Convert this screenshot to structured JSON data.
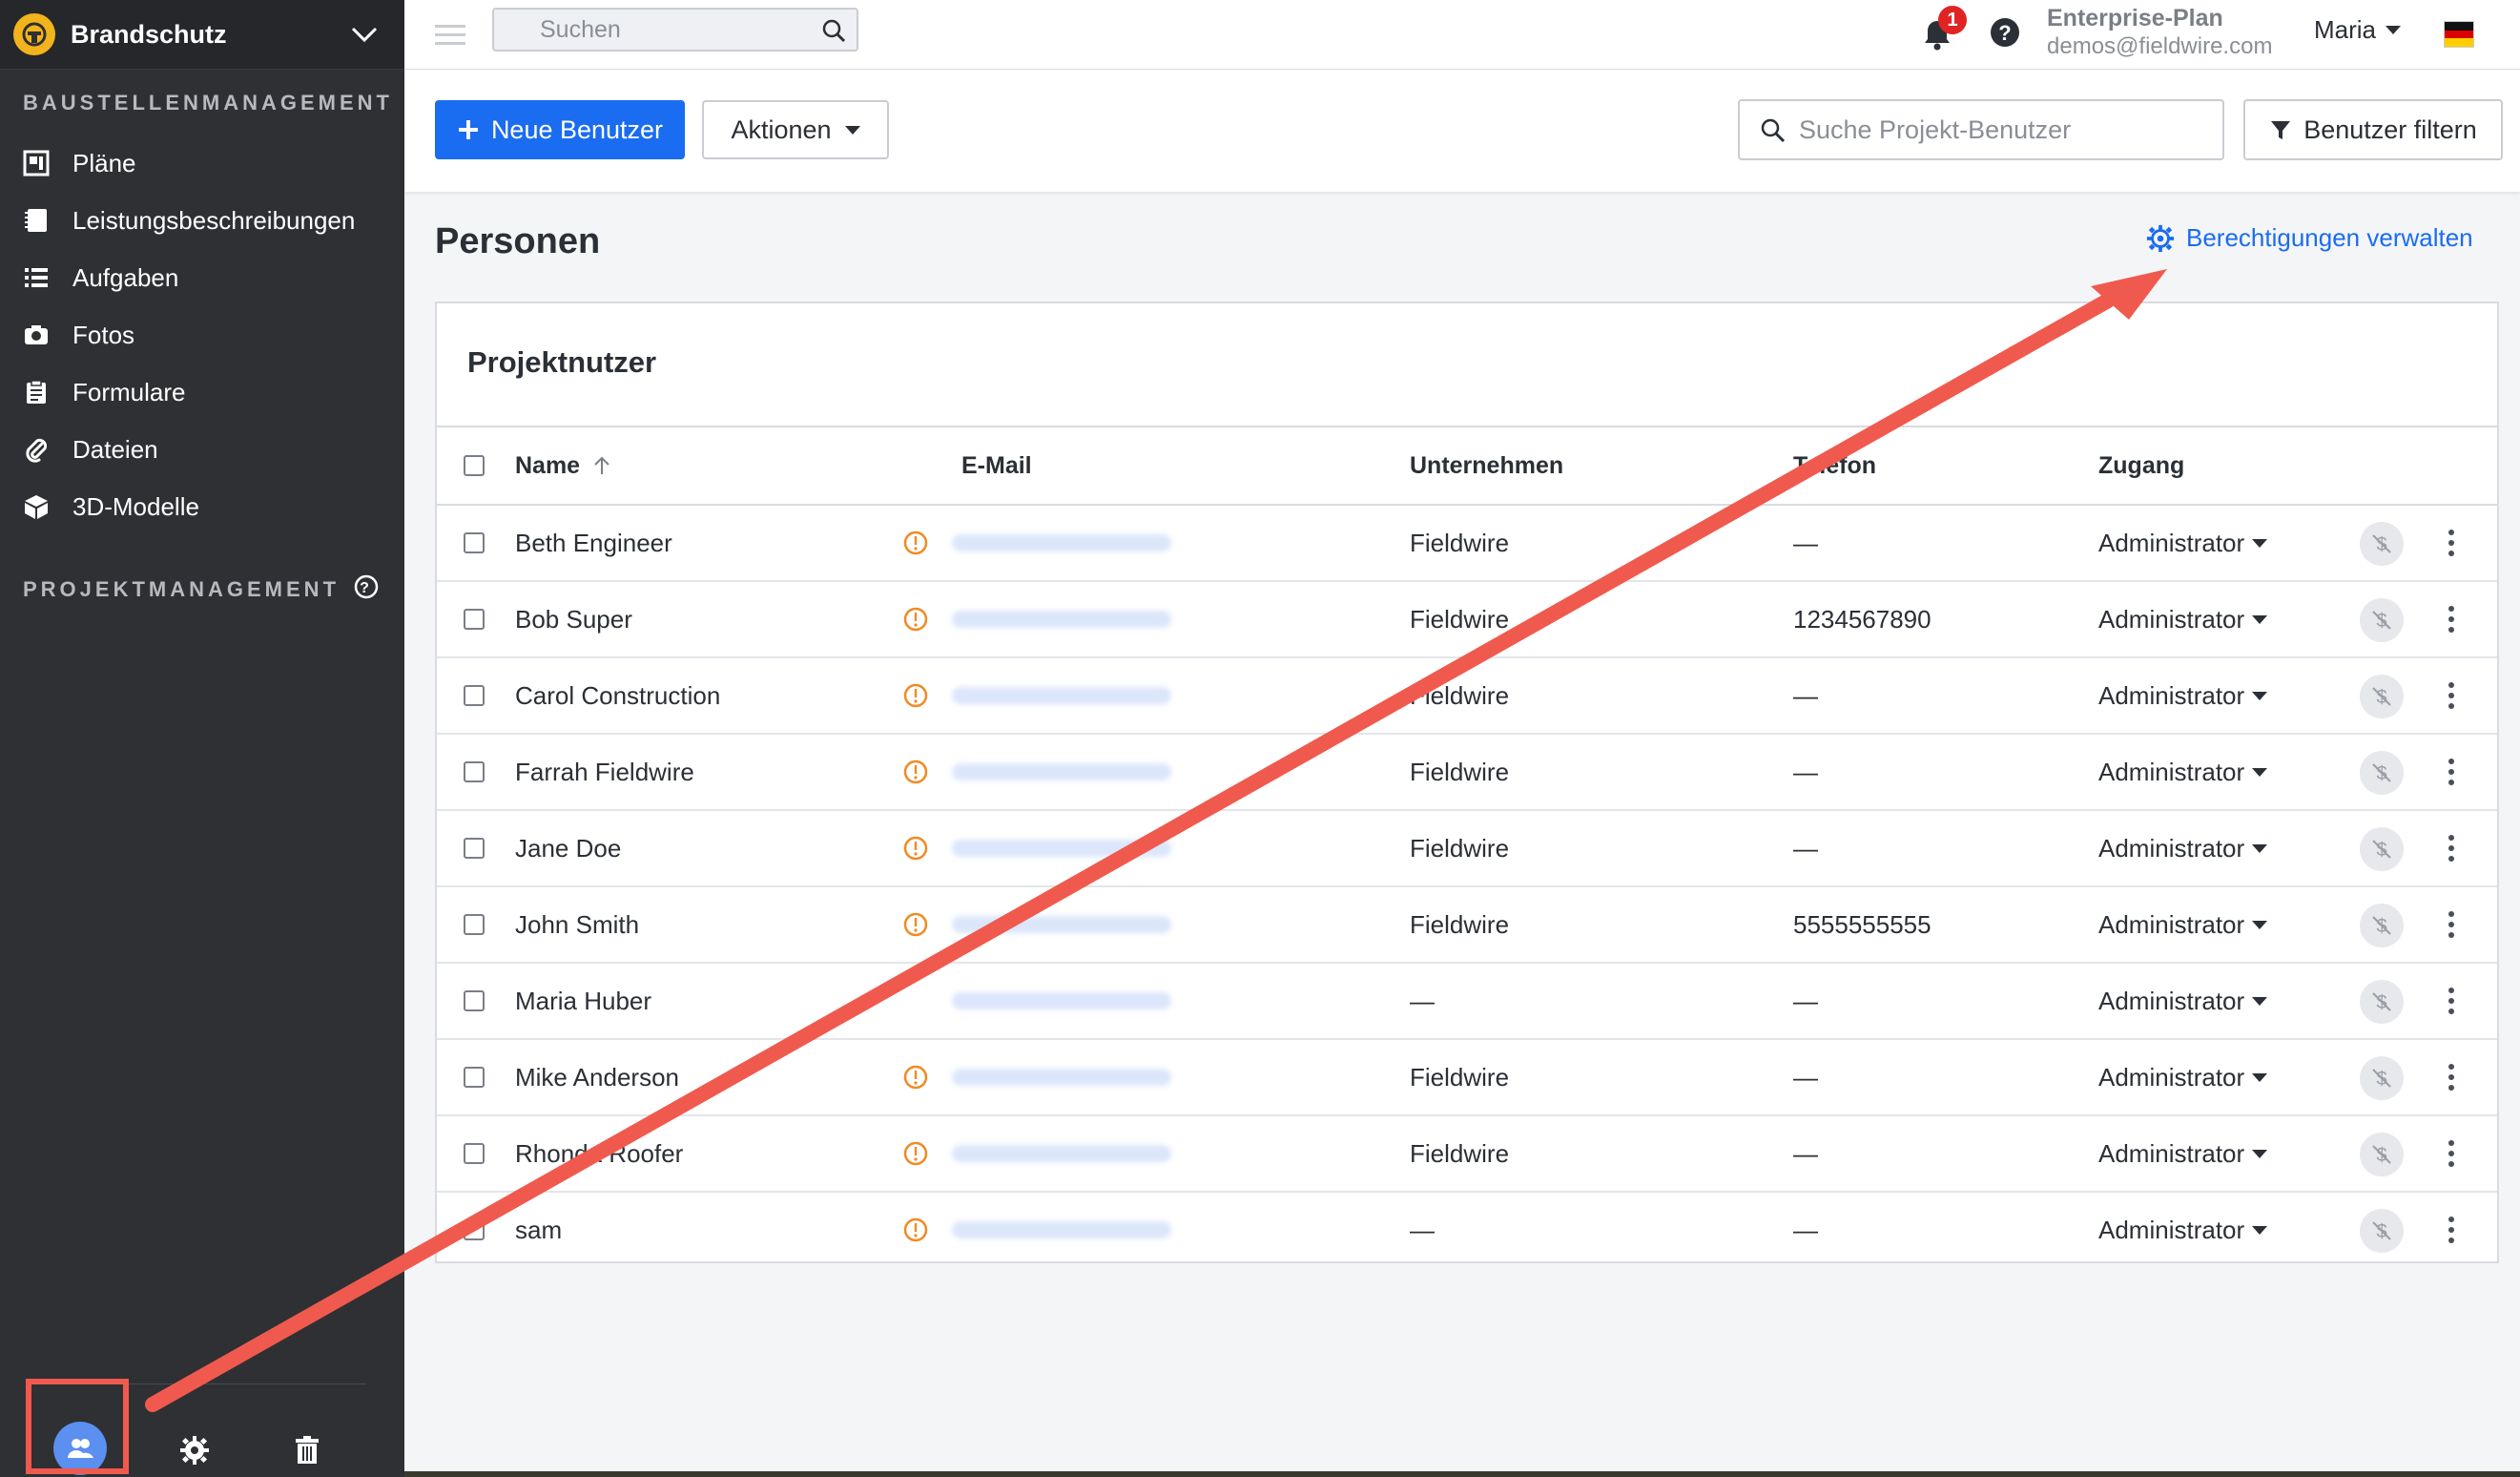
{
  "sidebar": {
    "project_name": "Brandschutz",
    "section_site": "BAUSTELLENMANAGEMENT",
    "items": [
      {
        "label": "Pläne",
        "icon": "plans-icon"
      },
      {
        "label": "Leistungsbeschreibungen",
        "icon": "specs-icon"
      },
      {
        "label": "Aufgaben",
        "icon": "tasks-icon"
      },
      {
        "label": "Fotos",
        "icon": "camera-icon"
      },
      {
        "label": "Formulare",
        "icon": "clipboard-icon"
      },
      {
        "label": "Dateien",
        "icon": "paperclip-icon"
      },
      {
        "label": "3D-Modelle",
        "icon": "cube-icon"
      }
    ],
    "section_project": "PROJEKTMANAGEMENT"
  },
  "topbar": {
    "search_placeholder": "Suchen",
    "notification_count": "1",
    "plan_name": "Enterprise-Plan",
    "email": "demos@fieldwire.com",
    "user_name": "Maria"
  },
  "actions": {
    "new_user": "Neue Benutzer",
    "actions": "Aktionen",
    "user_search_placeholder": "Suche Projekt-Benutzer",
    "filter": "Benutzer filtern"
  },
  "main": {
    "title": "Personen",
    "permissions_link": "Berechtigungen verwalten",
    "card_title": "Projektnutzer",
    "columns": {
      "name": "Name",
      "email": "E-Mail",
      "company": "Unternehmen",
      "phone": "Telefon",
      "access": "Zugang"
    },
    "rows": [
      {
        "name": "Beth Engineer",
        "warn": true,
        "company": "Fieldwire",
        "phone": "—",
        "access": "Administrator"
      },
      {
        "name": "Bob Super",
        "warn": true,
        "company": "Fieldwire",
        "phone": "1234567890",
        "access": "Administrator"
      },
      {
        "name": "Carol Construction",
        "warn": true,
        "company": "Fieldwire",
        "phone": "—",
        "access": "Administrator"
      },
      {
        "name": "Farrah Fieldwire",
        "warn": true,
        "company": "Fieldwire",
        "phone": "—",
        "access": "Administrator"
      },
      {
        "name": "Jane Doe",
        "warn": true,
        "company": "Fieldwire",
        "phone": "—",
        "access": "Administrator"
      },
      {
        "name": "John Smith",
        "warn": true,
        "company": "Fieldwire",
        "phone": "5555555555",
        "access": "Administrator"
      },
      {
        "name": "Maria Huber",
        "warn": false,
        "company": "—",
        "phone": "—",
        "access": "Administrator"
      },
      {
        "name": "Mike Anderson",
        "warn": true,
        "company": "Fieldwire",
        "phone": "—",
        "access": "Administrator"
      },
      {
        "name": "Rhonda Roofer",
        "warn": true,
        "company": "Fieldwire",
        "phone": "—",
        "access": "Administrator"
      },
      {
        "name": "sam",
        "warn": true,
        "company": "—",
        "phone": "—",
        "access": "Administrator"
      }
    ]
  },
  "colors": {
    "sidebar_bg": "#2f3033",
    "primary": "#1a6cf0",
    "warning": "#f08a24",
    "annotation": "#f05a4e"
  }
}
